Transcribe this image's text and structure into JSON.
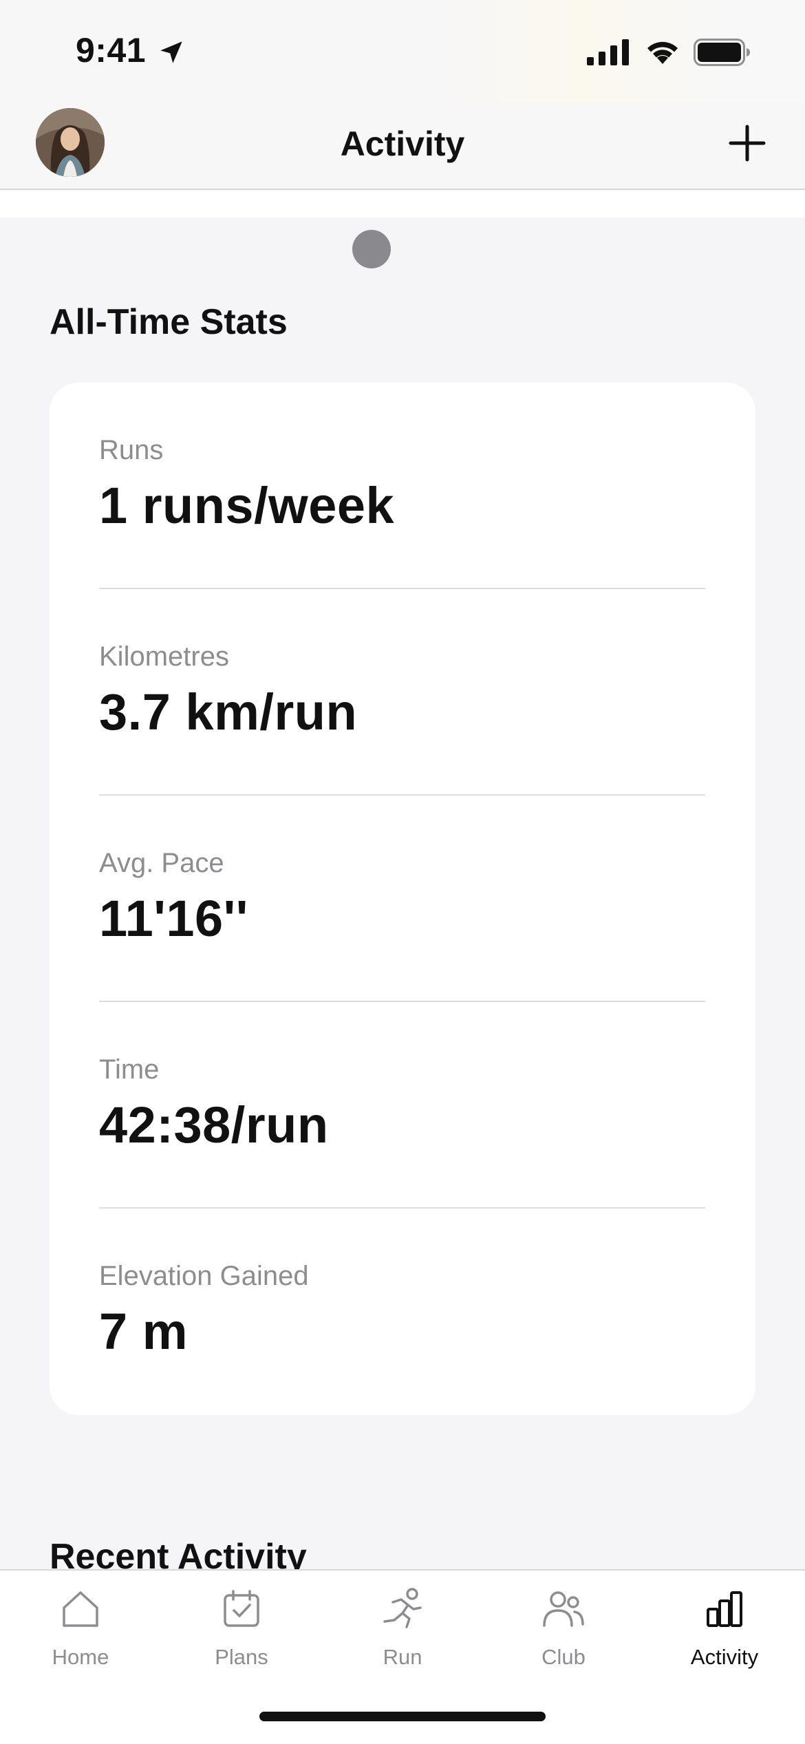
{
  "status_bar": {
    "time": "9:41",
    "icons": [
      "location-arrow-icon",
      "cellular-signal-icon",
      "wifi-icon",
      "battery-icon"
    ]
  },
  "header": {
    "title": "Activity",
    "avatar": "profile-avatar",
    "action_icon": "plus-icon"
  },
  "all_time_stats": {
    "title": "All-Time Stats",
    "items": [
      {
        "label": "Runs",
        "value": "1 runs/week"
      },
      {
        "label": "Kilometres",
        "value": "3.7 km/run"
      },
      {
        "label": "Avg. Pace",
        "value": "11'16''"
      },
      {
        "label": "Time",
        "value": "42:38/run"
      },
      {
        "label": "Elevation Gained",
        "value": "7 m"
      }
    ]
  },
  "recent_activity": {
    "title": "Recent Activity"
  },
  "tab_bar": {
    "active": "Activity",
    "tabs": [
      {
        "label": "Home",
        "icon": "home-icon"
      },
      {
        "label": "Plans",
        "icon": "calendar-check-icon"
      },
      {
        "label": "Run",
        "icon": "runner-icon"
      },
      {
        "label": "Club",
        "icon": "people-icon"
      },
      {
        "label": "Activity",
        "icon": "bar-chart-icon"
      }
    ]
  },
  "colors": {
    "background": "#f5f4f7",
    "card": "#ffffff",
    "label_gray": "#8d8d91",
    "text": "#111111"
  }
}
